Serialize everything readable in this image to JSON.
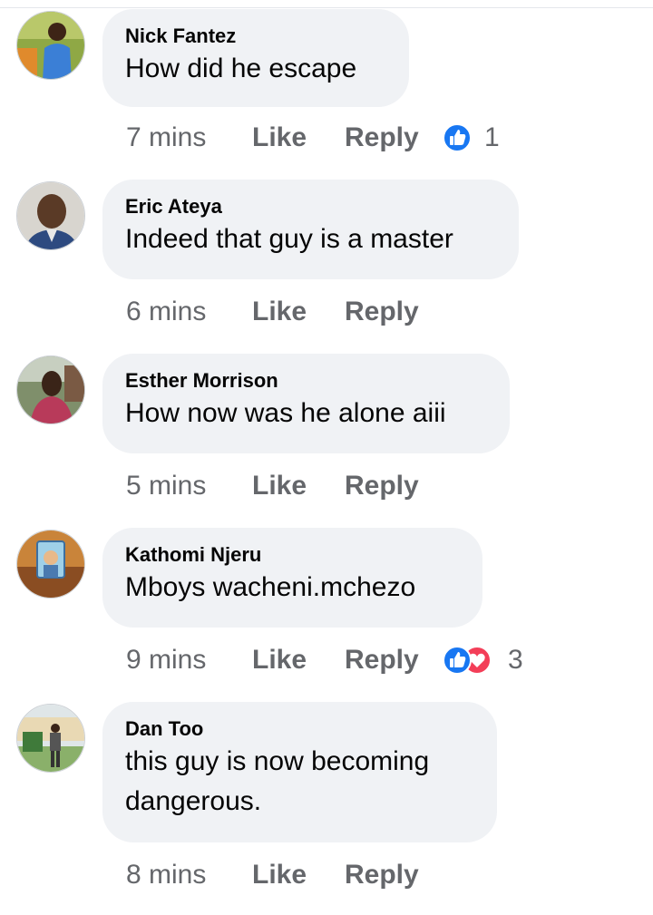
{
  "comments": [
    {
      "author": "Nick Fantez",
      "text_lines": [
        "How did he escape"
      ],
      "time": "7 mins",
      "like_label": "Like",
      "reply_label": "Reply",
      "reaction_icons": [
        "like-icon"
      ],
      "reaction_count": "1"
    },
    {
      "author": "Eric Ateya",
      "text_lines": [
        "Indeed that guy is a master"
      ],
      "time": "6 mins",
      "like_label": "Like",
      "reply_label": "Reply"
    },
    {
      "author": "Esther Morrison",
      "text_lines": [
        "How now was he alone aiii"
      ],
      "time": "5 mins",
      "like_label": "Like",
      "reply_label": "Reply"
    },
    {
      "author": "Kathomi Njeru",
      "text_lines": [
        "Mboys wacheni.mchezo"
      ],
      "time": "9 mins",
      "like_label": "Like",
      "reply_label": "Reply",
      "reaction_icons": [
        "like-icon",
        "love-icon"
      ],
      "reaction_count": "3"
    },
    {
      "author": "Dan Too",
      "text_lines": [
        "this guy is now becoming",
        "dangerous."
      ],
      "time": "8 mins",
      "like_label": "Like",
      "reply_label": "Reply"
    }
  ],
  "colors": {
    "bubble": "#f0f2f5",
    "secondary_text": "#65676b",
    "like_blue": "#1877f2",
    "love_red": "#f33e58"
  }
}
